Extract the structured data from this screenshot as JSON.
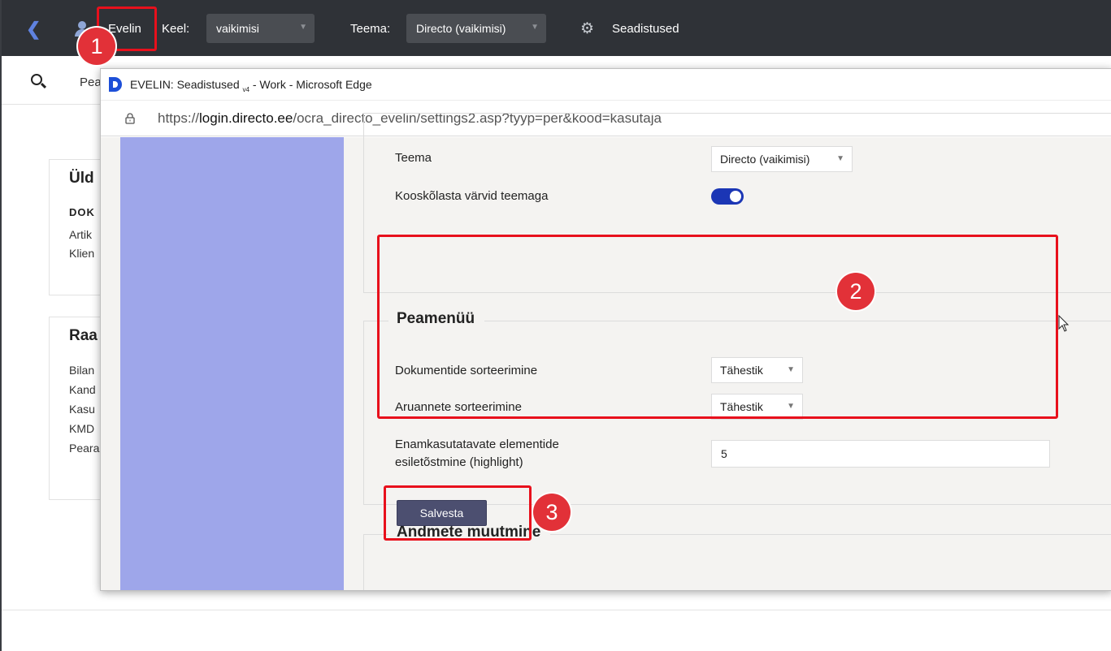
{
  "topbar": {
    "user_name": "Evelin",
    "language_label": "Keel:",
    "language_value": "vaikimisi",
    "theme_label": "Teema:",
    "theme_value": "Directo (vaikimisi)",
    "settings_label": "Seadistused"
  },
  "background": {
    "search_text": "Pea",
    "card1": {
      "title": "Üld",
      "subheading": "DOK",
      "items": [
        "Artik",
        "Klien"
      ]
    },
    "card2": {
      "title": "Raa",
      "items": [
        "Bilan",
        "Kand",
        "Kasu",
        "KMD",
        "Peara"
      ]
    }
  },
  "window": {
    "title_main": "EVELIN: Seadistused ",
    "title_version": "v4",
    "title_rest": " - Work - Microsoft Edge",
    "url_prefix": "https://",
    "url_host": "login.directo.ee",
    "url_path": "/ocra_directo_evelin/settings2.asp?tyyp=per&kood=kasutaja"
  },
  "theme_section": {
    "theme_label": "Teema",
    "theme_value": "Directo (vaikimisi)",
    "coordinate_label": "Kooskõlasta värvid teemaga",
    "coordinate_enabled": true
  },
  "main_menu_section": {
    "title": "Peamenüü",
    "doc_sort_label": "Dokumentide sorteerimine",
    "doc_sort_value": "Tähestik",
    "report_sort_label": "Aruannete sorteerimine",
    "report_sort_value": "Tähestik",
    "highlight_label_line1": "Enamkasutatavate elementide",
    "highlight_label_line2": "esiletõstmine (highlight)",
    "highlight_value": "5"
  },
  "data_change_section": {
    "title": "Andmete muutmine",
    "save_label": "Salvesta"
  },
  "annotations": {
    "n1": "1",
    "n2": "2",
    "n3": "3"
  },
  "colors": {
    "topbar": "#2f3237",
    "accent": "#1b36b5",
    "sidepanel": "#9ea6ea",
    "highlight": "#e8101c"
  }
}
